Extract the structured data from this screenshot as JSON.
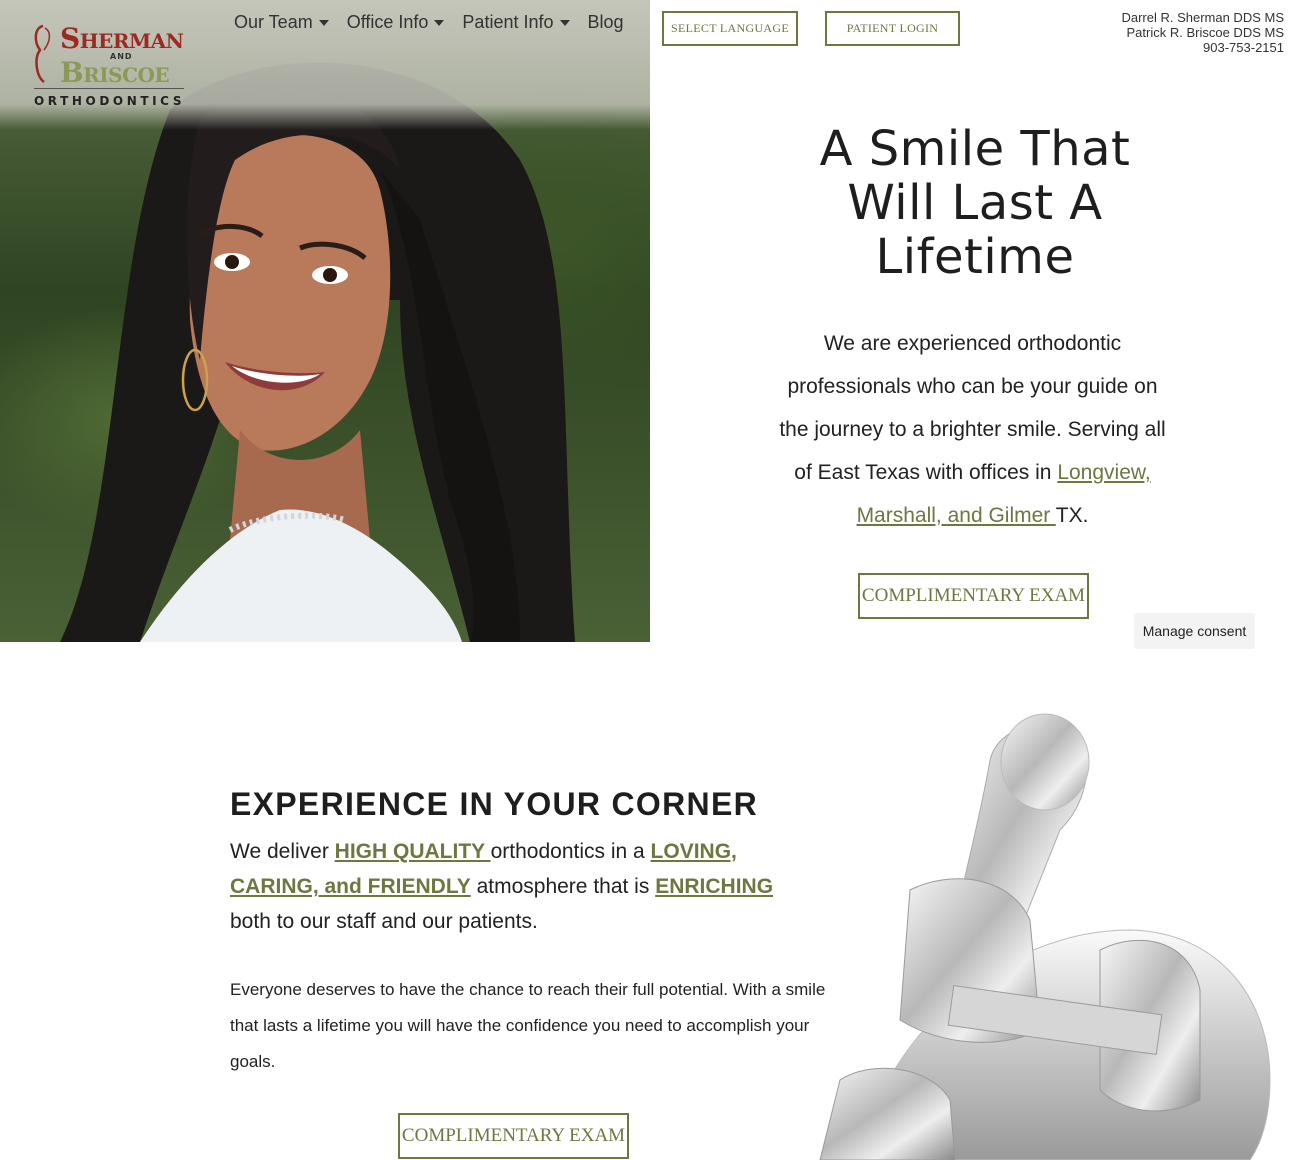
{
  "brand": {
    "name_top": "Sherman",
    "name_and": "AND",
    "name_bottom": "Briscoe",
    "tagline": "ORTHODONTICS",
    "colors": {
      "red": "#9b2a23",
      "green": "#8a9a56",
      "accent": "#6f7740"
    }
  },
  "nav": {
    "items": [
      {
        "label": "Our Team",
        "has_dropdown": true
      },
      {
        "label": "Office Info",
        "has_dropdown": true
      },
      {
        "label": "Patient Info",
        "has_dropdown": true
      },
      {
        "label": "Blog",
        "has_dropdown": false
      }
    ]
  },
  "header": {
    "language_button": "SELECT LANGUAGE",
    "login_button": "PATIENT LOGIN",
    "doctors": [
      "Darrel R. Sherman DDS MS",
      "Patrick R. Briscoe DDS MS"
    ],
    "phone": "903-753-2151"
  },
  "hero": {
    "title": "A Smile That Will Last A Lifetime",
    "copy_before_link": "We are experienced orthodontic professionals who can be your guide on the journey to a brighter smile.  Serving all of East Texas with offices in ",
    "copy_link": "Longview, Marshall, and Gilmer ",
    "copy_after_link": "TX.",
    "cta": "COMPLIMENTARY EXAM"
  },
  "consent": {
    "label": "Manage consent"
  },
  "experience": {
    "heading": "EXPERIENCE IN YOUR CORNER",
    "t1": "We deliver ",
    "l1": "HIGH QUALITY ",
    "t2": "orthodontics in a ",
    "l2": "LOVING, CARING, and FRIENDLY",
    "t3": " atmosphere that is ",
    "l3": "ENRICHING",
    "t4": " both to our staff and our patients.",
    "body": "Everyone deserves to have the chance to reach their full potential. With a smile that lasts a lifetime you will have the confidence you need to accomplish your goals.",
    "cta": "COMPLIMENTARY EXAM"
  }
}
